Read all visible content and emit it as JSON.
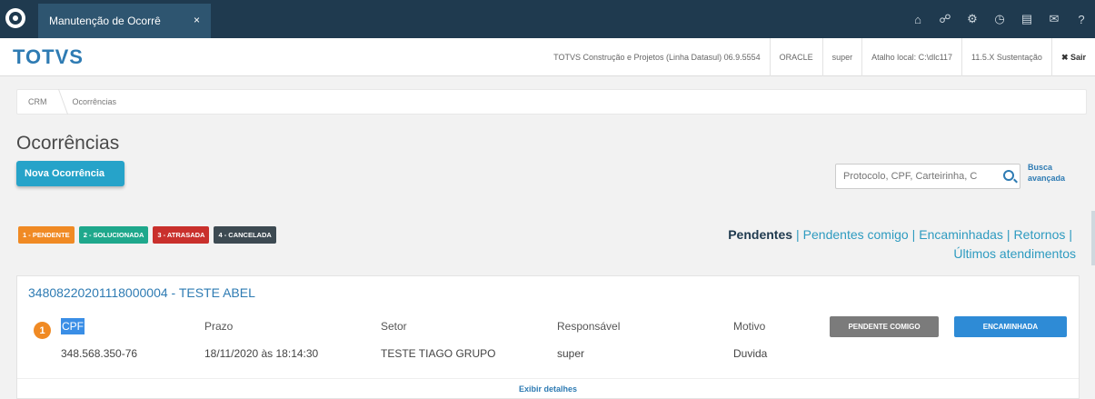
{
  "topbar": {
    "tab_title": "Manutenção de Ocorrê",
    "tab_close": "×",
    "icons": [
      "home-icon",
      "network-icon",
      "gear-icon",
      "clock-icon",
      "document-icon",
      "mail-icon",
      "help-icon"
    ]
  },
  "subbar": {
    "brand": "TOTVS",
    "company": "TOTVS Construção e Projetos (Linha Datasul) 06.9.5554",
    "db": "ORACLE",
    "user": "super",
    "shortcut": "Atalho local: C:\\dlc117",
    "version": "11.5.X Sustentação",
    "logout": "✖ Sair"
  },
  "breadcrumb": {
    "root": "CRM",
    "current": "Ocorrências"
  },
  "page": {
    "title": "Ocorrências",
    "new_button": "Nova Ocorrência",
    "search_placeholder": "Protocolo, CPF, Carteirinha, C",
    "advanced_search": "Busca avançada"
  },
  "legend": [
    {
      "label": "1 - PENDENTE",
      "color": "#f08a24"
    },
    {
      "label": "2 - SOLUCIONADA",
      "color": "#1fa88c"
    },
    {
      "label": "3 - ATRASADA",
      "color": "#c9302c"
    },
    {
      "label": "4 - CANCELADA",
      "color": "#3d4a52"
    }
  ],
  "filters": {
    "pendentes": "Pendentes",
    "pendentes_comigo": "Pendentes comigo",
    "encaminhadas": "Encaminhadas",
    "retornos": "Retornos",
    "ultimos": "Últimos atendimentos",
    "separator": "|"
  },
  "occurrence": {
    "title": "34808220201118000004 - TESTE ABEL",
    "status_number": "1",
    "headers": {
      "cpf": "CPF",
      "prazo": "Prazo",
      "setor": "Setor",
      "responsavel": "Responsável",
      "motivo": "Motivo"
    },
    "values": {
      "cpf": "348.568.350-76",
      "prazo": "18/11/2020 às 18:14:30",
      "setor": "TESTE TIAGO GRUPO",
      "responsavel": "super",
      "motivo": "Duvida"
    },
    "btn_pendente_comigo": "PENDENTE COMIGO",
    "btn_encaminhada": "ENCAMINHADA",
    "details_link": "Exibir detalhes"
  }
}
